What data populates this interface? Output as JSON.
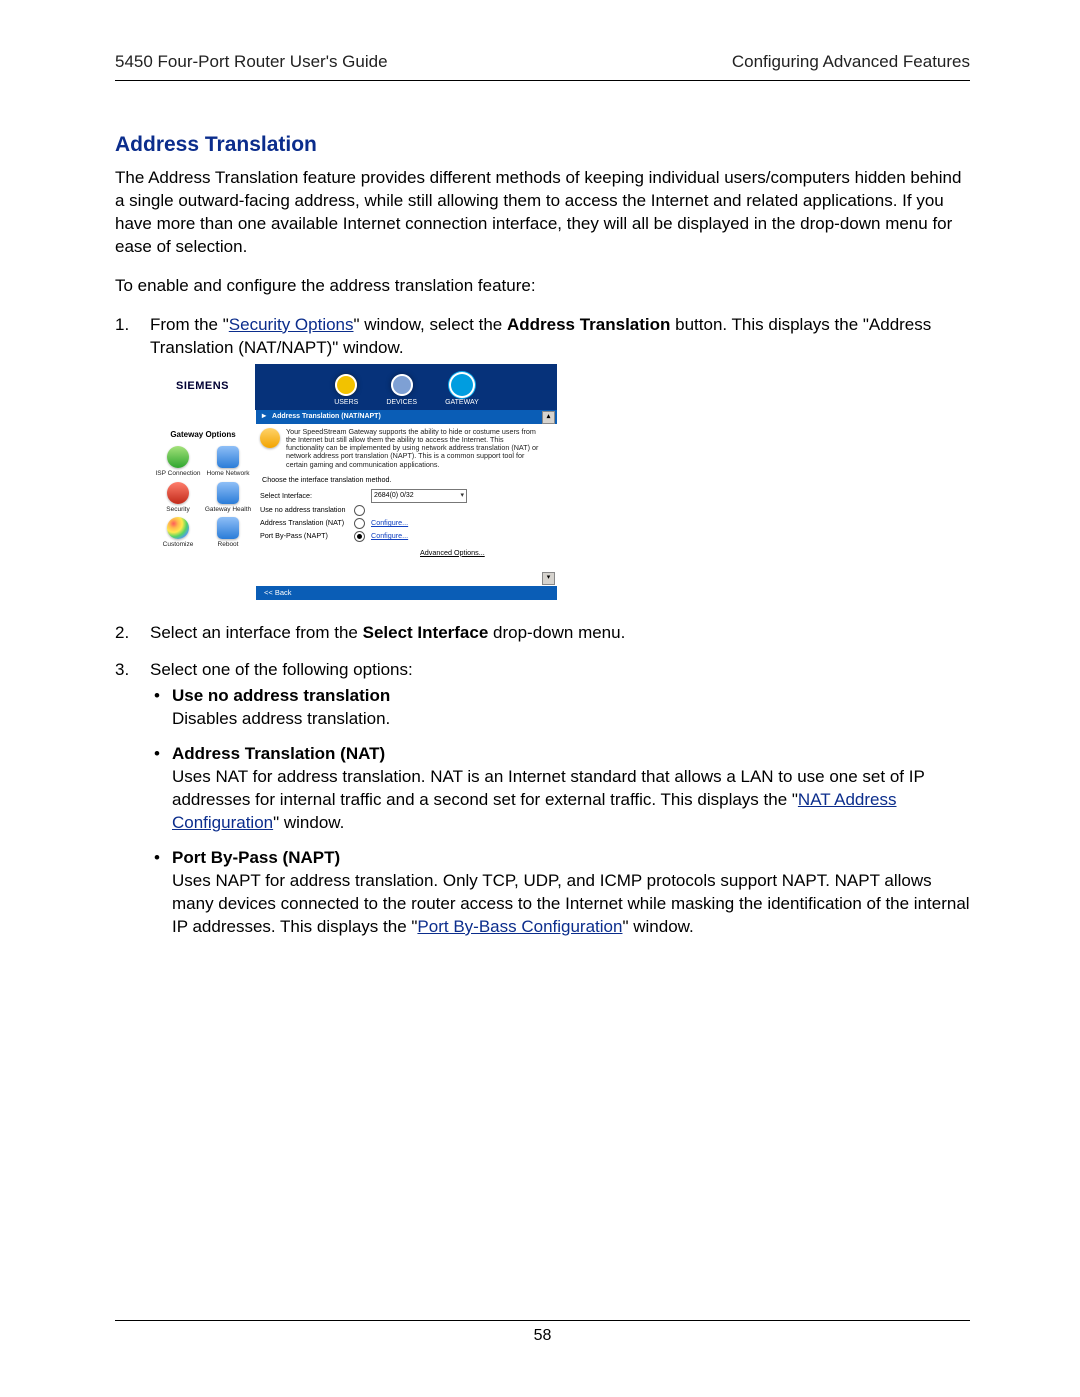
{
  "header": {
    "left": "5450 Four-Port Router User's Guide",
    "right": "Configuring Advanced Features"
  },
  "heading": "Address Translation",
  "intro": "The Address Translation feature provides different methods of keeping individual users/computers hidden behind a single outward-facing address, while still allowing them to access the Internet and related applications. If you have more than one available Internet connection interface, they will all be displayed in the drop-down menu for ease of selection.",
  "lead": "To enable and configure the address translation feature:",
  "steps": {
    "s1": {
      "num": "1.",
      "pre": "From the \"",
      "link": "Security Options",
      "mid": "\" window, select the ",
      "bold": "Address Translation",
      "post": " button. This displays the \"Address Translation (NAT/NAPT)\" window."
    },
    "s2": {
      "num": "2.",
      "pre": "Select an interface from the ",
      "bold": "Select Interface",
      "post": " drop-down menu."
    },
    "s3": {
      "num": "3.",
      "text": "Select one of the following options:"
    }
  },
  "bullets": {
    "b1": {
      "title": "Use no address translation",
      "text": "Disables address translation."
    },
    "b2": {
      "title": "Address Translation (NAT)",
      "text1": "Uses NAT for address translation. NAT is an Internet standard that allows a LAN to use one set of IP addresses for internal traffic and a second set for external traffic. This displays the \"",
      "link": "NAT Address Configuration",
      "text2": "\" window."
    },
    "b3": {
      "title": "Port By-Pass (NAPT)",
      "text1": "Uses NAPT for address translation. Only TCP, UDP, and ICMP protocols support NAPT. NAPT allows many devices connected to the router access to the Internet while masking the identification of the internal IP addresses. This displays the \"",
      "link": "Port By-Bass Configuration",
      "text2": "\" window."
    }
  },
  "pageNumber": "58",
  "shot": {
    "logo": "SIEMENS",
    "tabs": {
      "users": "USERS",
      "devices": "DEVICES",
      "gateway": "GATEWAY"
    },
    "breadcrumb": "Address Translation (NAT/NAPT)",
    "side": {
      "title": "Gateway Options",
      "items": {
        "isp": "ISP Connection",
        "home": "Home Network",
        "sec": "Security",
        "gh": "Gateway Health",
        "cust": "Customize",
        "reboot": "Reboot"
      }
    },
    "main": {
      "desc": "Your SpeedStream Gateway supports the ability to hide or costume users from the Internet but still allow them the ability to access the Internet. This functionality can be implemented by using network address translation (NAT) or network address port translation (NAPT). This is a common support tool for certain gaming and communication applications.",
      "sub": "Choose the interface translation method.",
      "selectLabel": "Select Interface:",
      "selectValue": "2684(0) 0/32",
      "opt1": "Use no address translation",
      "opt2": "Address Translation (NAT)",
      "opt3": "Port By-Pass (NAPT)",
      "configure": "Configure...",
      "advanced": "Advanced Options...",
      "back": "<< Back"
    }
  }
}
